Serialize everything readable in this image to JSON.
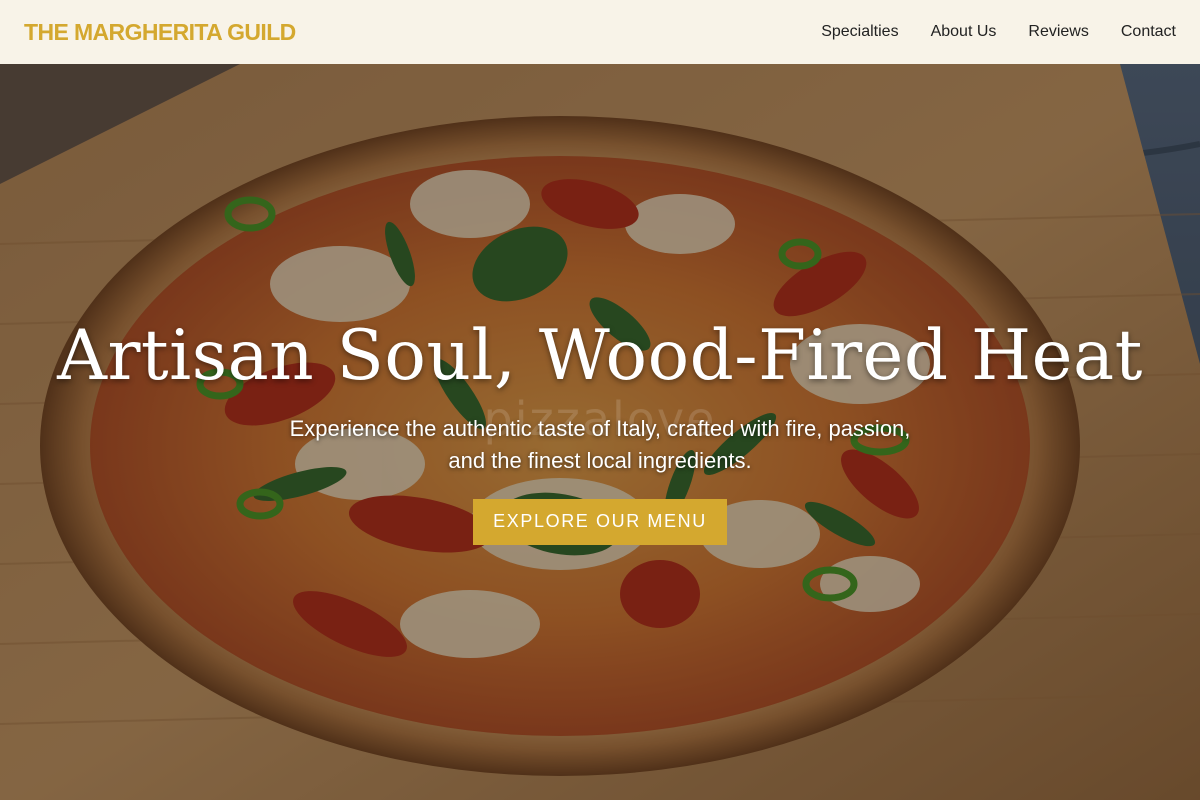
{
  "header": {
    "logo": "THE MARGHERITA GUILD",
    "nav": [
      {
        "label": "Specialties"
      },
      {
        "label": "About Us"
      },
      {
        "label": "Reviews"
      },
      {
        "label": "Contact"
      }
    ]
  },
  "hero": {
    "title": "Artisan Soul, Wood-Fired Heat",
    "subtitle": "Experience the authentic taste of Italy, crafted with fire, passion, and the finest local ingredients.",
    "cta_label": "EXPLORE OUR MENU",
    "watermark": "pizzalove"
  },
  "colors": {
    "accent": "#d4a82f",
    "header_bg": "#f8f3e8",
    "nav_text": "#222222",
    "hero_text": "#ffffff"
  }
}
